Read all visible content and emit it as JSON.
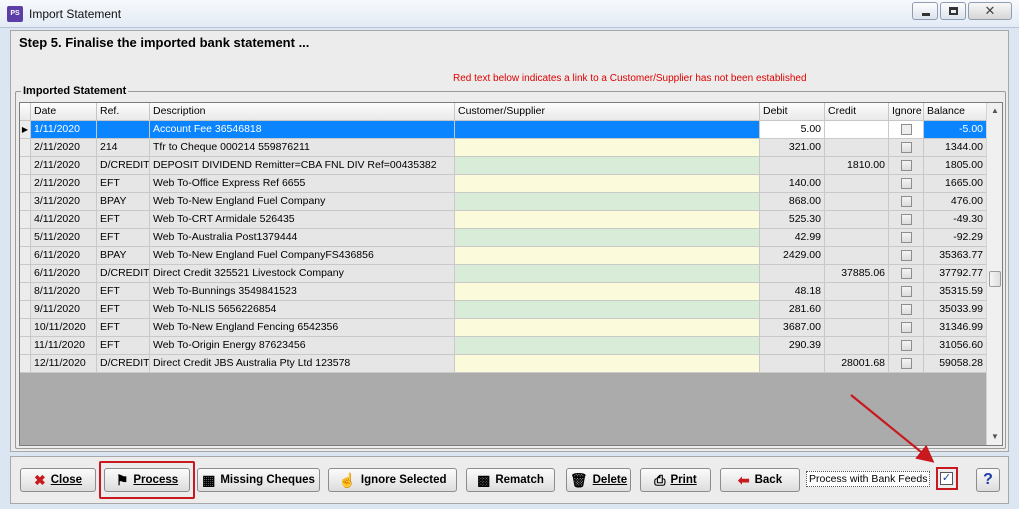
{
  "window": {
    "title": "Import Statement",
    "app_icon": "PS"
  },
  "step_title": "Step 5. Finalise the imported bank statement ...",
  "red_note": "Red text below indicates a link to a Customer/Supplier has not been established",
  "group_label": "Imported Statement",
  "columns": [
    "",
    "Date",
    "Ref.",
    "Description",
    "Customer/Supplier",
    "Debit",
    "Credit",
    "Ignore",
    "Balance"
  ],
  "rows": [
    {
      "date": "1/11/2020",
      "ref": "",
      "desc": "Account Fee 36546818",
      "cust": "",
      "debit": "5.00",
      "credit": "",
      "balance": "-5.00"
    },
    {
      "date": "2/11/2020",
      "ref": "214",
      "desc": "Tfr to Cheque 000214 559876211",
      "cust": "",
      "debit": "321.00",
      "credit": "",
      "balance": "1344.00"
    },
    {
      "date": "2/11/2020",
      "ref": "D/CREDIT",
      "desc": "DEPOSIT DIVIDEND Remitter=CBA FNL DIV Ref=00435382",
      "cust": "",
      "debit": "",
      "credit": "1810.00",
      "balance": "1805.00"
    },
    {
      "date": "2/11/2020",
      "ref": "EFT",
      "desc": "Web To-Office Express Ref 6655",
      "cust": "",
      "debit": "140.00",
      "credit": "",
      "balance": "1665.00"
    },
    {
      "date": "3/11/2020",
      "ref": "BPAY",
      "desc": "Web To-New England Fuel Company",
      "cust": "",
      "debit": "868.00",
      "credit": "",
      "balance": "476.00"
    },
    {
      "date": "4/11/2020",
      "ref": "EFT",
      "desc": "Web To-CRT Armidale 526435",
      "cust": "",
      "debit": "525.30",
      "credit": "",
      "balance": "-49.30"
    },
    {
      "date": "5/11/2020",
      "ref": "EFT",
      "desc": "Web To-Australia Post1379444",
      "cust": "",
      "debit": "42.99",
      "credit": "",
      "balance": "-92.29"
    },
    {
      "date": "6/11/2020",
      "ref": "BPAY",
      "desc": "Web To-New England Fuel CompanyFS436856",
      "cust": "",
      "debit": "2429.00",
      "credit": "",
      "balance": "35363.77"
    },
    {
      "date": "6/11/2020",
      "ref": "D/CREDIT",
      "desc": "Direct Credit 325521 Livestock Company",
      "cust": "",
      "debit": "",
      "credit": "37885.06",
      "balance": "37792.77"
    },
    {
      "date": "8/11/2020",
      "ref": "EFT",
      "desc": "Web To-Bunnings 3549841523",
      "cust": "",
      "debit": "48.18",
      "credit": "",
      "balance": "35315.59"
    },
    {
      "date": "9/11/2020",
      "ref": "EFT",
      "desc": "Web To-NLIS 5656226854",
      "cust": "",
      "debit": "281.60",
      "credit": "",
      "balance": "35033.99"
    },
    {
      "date": "10/11/2020",
      "ref": "EFT",
      "desc": "Web To-New England Fencing 6542356",
      "cust": "",
      "debit": "3687.00",
      "credit": "",
      "balance": "31346.99"
    },
    {
      "date": "11/11/2020",
      "ref": "EFT",
      "desc": "Web To-Origin Energy 87623456",
      "cust": "",
      "debit": "290.39",
      "credit": "",
      "balance": "31056.60"
    },
    {
      "date": "12/11/2020",
      "ref": "D/CREDIT",
      "desc": "Direct Credit JBS Australia Pty Ltd 123578",
      "cust": "",
      "debit": "",
      "credit": "28001.68",
      "balance": "59058.28"
    }
  ],
  "selected_row": 0,
  "toolbar": {
    "close": "Close",
    "process": "Process",
    "missing_cheques": "Missing Cheques",
    "ignore_selected": "Ignore Selected",
    "rematch": "Rematch",
    "delete": "Delete",
    "print": "Print",
    "back": "Back",
    "process_bank_feeds": "Process with Bank Feeds",
    "process_bank_feeds_checked": true,
    "help": "?"
  },
  "colors": {
    "selection": "#0a84ff",
    "customer_cell_green": "#d8ecd8",
    "customer_cell_yellow": "#fbfbdc",
    "red_note": "#e00000",
    "annotation_red": "#c8191e"
  },
  "icons": {
    "close": "x-icon",
    "process": "checkered-flag-icon",
    "missing_cheques": "cheque-icon",
    "ignore_selected": "ignore-icon",
    "rematch": "rematch-icon",
    "delete": "trash-icon",
    "print": "printer-icon",
    "back": "back-arrow-icon",
    "help": "help-icon"
  }
}
